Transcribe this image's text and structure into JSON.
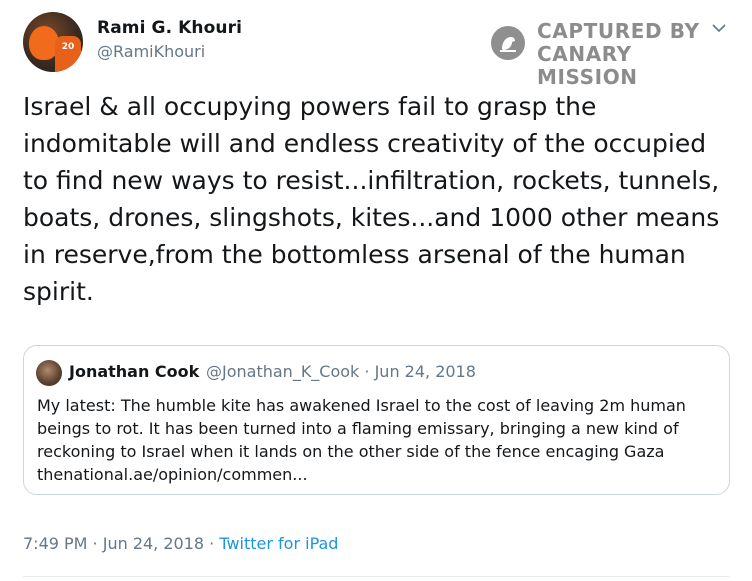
{
  "author": {
    "name": "Rami G. Khouri",
    "handle": "@RamiKhouri",
    "avatar_jersey_number": "20"
  },
  "watermark": {
    "line1": "CAPTURED BY",
    "line2": "CANARY MISSION"
  },
  "tweet": {
    "text": "Israel & all occupying powers fail to grasp the\nindomitable will and endless creativity of the occupied\nto find new ways to resist...infiltration, rockets, tunnels,\nboats, drones, slingshots, kites...and 1000 other means\nin reserve,from the bottomless arsenal of the human\nspirit."
  },
  "quoted_tweet": {
    "name": "Jonathan Cook",
    "meta": "@Jonathan_K_Cook · Jun 24, 2018",
    "text": "My latest: The humble kite has awakened Israel to the cost of leaving 2m human\nbeings to rot. It has been turned into a flaming emissary, bringing a new kind of\nreckoning to Israel when it lands on the other side of the fence encaging Gaza\nthenational.ae/opinion/commen..."
  },
  "footer": {
    "time_date": "7:49 PM · Jun 24, 2018 · ",
    "source": "Twitter for iPad"
  },
  "icons": {
    "menu": "chevron-down-icon",
    "watermark": "canary-logo-icon"
  },
  "colors": {
    "text": "#14171a",
    "secondary": "#657786",
    "link": "#1b95e0",
    "border": "#ccd6dd",
    "watermark": "#8c8c8c"
  }
}
